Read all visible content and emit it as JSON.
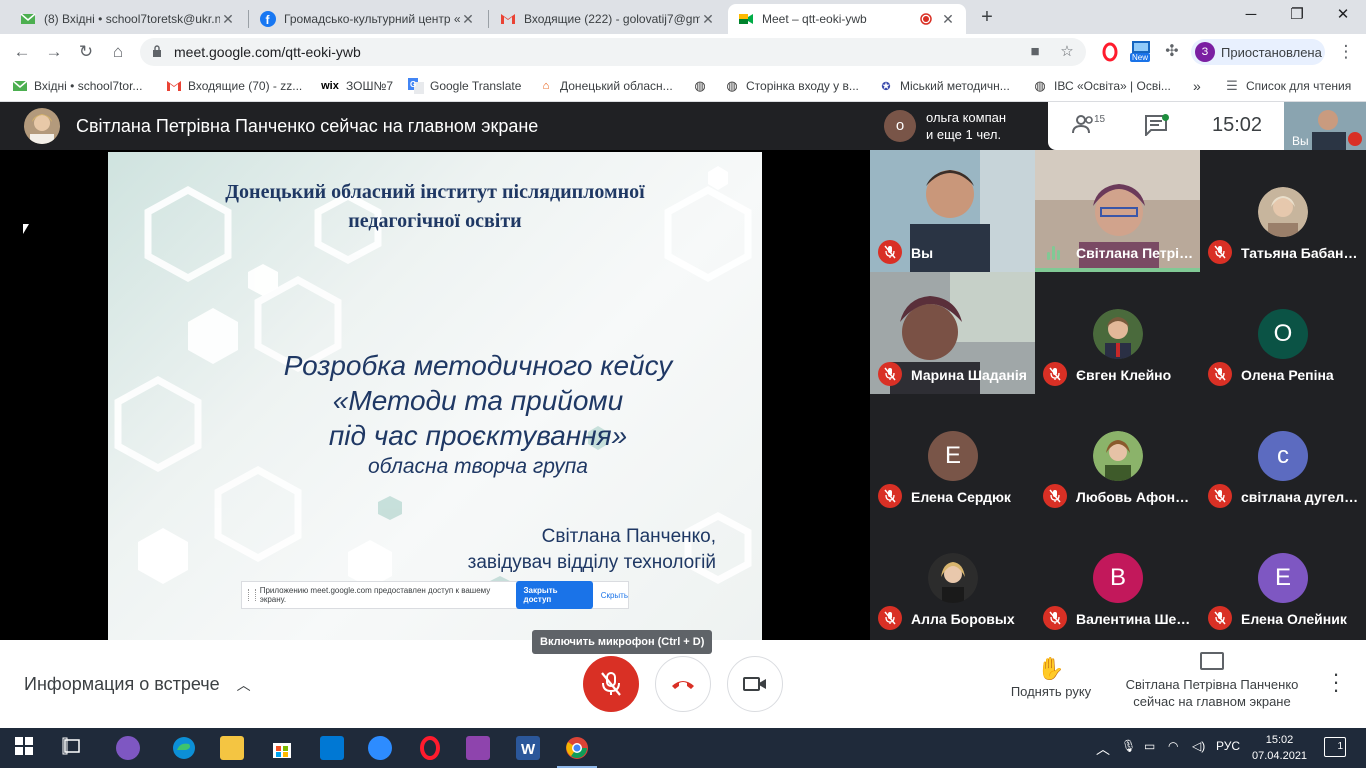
{
  "browser": {
    "tabs": [
      {
        "title": "(8) Вхідні • school7toretsk@ukr.n",
        "icon": "ukrnet-mail-icon"
      },
      {
        "title": "Громадсько-культурний центр «",
        "icon": "facebook-icon"
      },
      {
        "title": "Входящие (222) - golovatij7@gm",
        "icon": "gmail-icon"
      },
      {
        "title": "Meet – qtt-eoki-ywb",
        "icon": "google-meet-icon",
        "active": true
      }
    ],
    "new_tab_label": "+",
    "url": "meet.google.com/qtt-eoki-ywb",
    "profile_initial": "З",
    "profile_label": "Приостановлена",
    "ext_new_badge": "New",
    "bookmarks": [
      {
        "label": "Вхідні • school7tor...",
        "icon": "ukrnet-mail-icon"
      },
      {
        "label": "Входящие (70) - zz...",
        "icon": "gmail-icon"
      },
      {
        "label": "ЗОШ№7",
        "icon": "wix-icon"
      },
      {
        "label": "Google Translate",
        "icon": "google-translate-icon"
      },
      {
        "label": "Донецький обласн...",
        "icon": "building-icon"
      },
      {
        "label": "",
        "icon": "globe-icon"
      },
      {
        "label": "Сторінка входу у в...",
        "icon": "globe-icon"
      },
      {
        "label": "Міський методичн...",
        "icon": "ribbon-icon"
      },
      {
        "label": "ІВС «Освіта» | Осві...",
        "icon": "globe-icon"
      }
    ],
    "bookmarks_overflow": "»",
    "reading_list": "Список для чтения"
  },
  "meet": {
    "presenter_banner": "Світлана Петрівна Панченко сейчас на главном экране",
    "joiner": {
      "initial": "о",
      "line1": "ольга компан",
      "line2": "и еще 1 чел."
    },
    "people_count": "15",
    "time": "15:02",
    "self_label": "Вы",
    "slide": {
      "institute_line1": "Донецький обласний інститут післядипломної",
      "institute_line2": "педагогічної освіти",
      "title_line1": "Розробка методичного кейсу",
      "title_line2": "«Методи та прийоми",
      "title_line3": "під час проєктування»",
      "group": "обласна творча група",
      "author_line1": "Світлана Панченко,",
      "author_line2": "завідувач відділу технологій",
      "share_notice": "Приложению meet.google.com предоставлен доступ к вашему экрану.",
      "share_stop": "Закрыть доступ",
      "share_hide": "Скрыть"
    },
    "participants": [
      {
        "name": "Вы",
        "type": "video",
        "muted": true
      },
      {
        "name": "Світлана Петрів...",
        "type": "video",
        "speaking": true
      },
      {
        "name": "Татьяна Бабанс...",
        "type": "photo",
        "muted": true
      },
      {
        "name": "Марина Шаданія",
        "type": "video",
        "muted": true
      },
      {
        "name": "Євген Клейно",
        "type": "photo",
        "muted": true
      },
      {
        "name": "Олена Репіна",
        "type": "letter",
        "initial": "О",
        "color": "#0b5345",
        "muted": true
      },
      {
        "name": "Елена Сердюк",
        "type": "letter",
        "initial": "Е",
        "color": "#795548",
        "muted": true
      },
      {
        "name": "Любовь Афони...",
        "type": "photo",
        "muted": true
      },
      {
        "name": "світлана дугель...",
        "type": "letter",
        "initial": "с",
        "color": "#5c6bc0",
        "muted": true
      },
      {
        "name": "Алла Боровых",
        "type": "photo",
        "muted": true
      },
      {
        "name": "Валентина Шеп...",
        "type": "letter",
        "initial": "В",
        "color": "#c2185b",
        "muted": true
      },
      {
        "name": "Елена Олейник",
        "type": "letter",
        "initial": "Е",
        "color": "#7e57c2",
        "muted": true
      }
    ],
    "bottom": {
      "meeting_info": "Информация о встрече",
      "mic_tooltip": "Включить микрофон (Ctrl + D)",
      "raise_hand": "Поднять руку",
      "presenting_line1": "Світлана Петрівна Панченко",
      "presenting_line2": "сейчас на главном экране"
    }
  },
  "taskbar": {
    "lang": "РУС",
    "time": "15:02",
    "date": "07.04.2021",
    "notif_count": "1"
  }
}
